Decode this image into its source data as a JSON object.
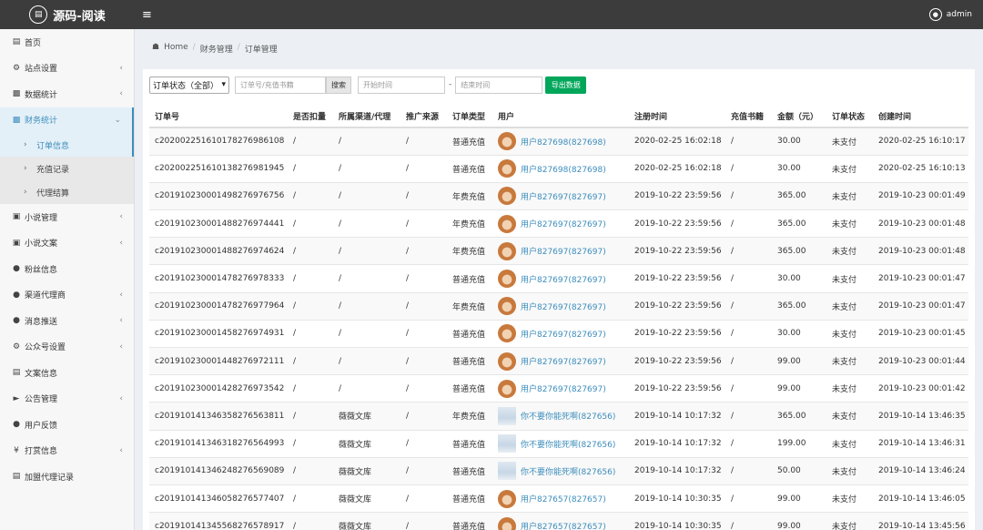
{
  "header": {
    "brand": "源码-阅读",
    "user": "admin",
    "menu_icon": "bars-icon"
  },
  "sidebar": {
    "items": [
      {
        "label": "首页",
        "icon": "dashboard-icon",
        "chev": false
      },
      {
        "label": "站点设置",
        "icon": "gear-icon",
        "chev": true
      },
      {
        "label": "数据统计",
        "icon": "bar-chart-icon",
        "chev": true
      },
      {
        "label": "财务统计",
        "icon": "bar-chart-icon",
        "chev": true,
        "active": true
      },
      {
        "label": "小说管理",
        "icon": "book-icon",
        "chev": true
      },
      {
        "label": "小说文案",
        "icon": "book-icon",
        "chev": true
      },
      {
        "label": "粉丝信息",
        "icon": "users-icon",
        "chev": false
      },
      {
        "label": "渠道代理商",
        "icon": "user-plus-icon",
        "chev": true
      },
      {
        "label": "消息推送",
        "icon": "comment-icon",
        "chev": true
      },
      {
        "label": "公众号设置",
        "icon": "cogs-icon",
        "chev": true
      },
      {
        "label": "文案信息",
        "icon": "newspaper-icon",
        "chev": false
      },
      {
        "label": "公告管理",
        "icon": "bullhorn-icon",
        "chev": true
      },
      {
        "label": "用户反馈",
        "icon": "comment-icon",
        "chev": false
      },
      {
        "label": "打赏信息",
        "icon": "yen-icon",
        "chev": true
      },
      {
        "label": "加盟代理记录",
        "icon": "id-card-icon",
        "chev": false
      }
    ],
    "sub_items": [
      "订单信息",
      "充值记录",
      "代理结算"
    ]
  },
  "breadcrumb": [
    "Home",
    "财务管理",
    "订单管理"
  ],
  "filters": {
    "status_select": "订单状态（全部）",
    "search_placeholder": "订单号/充值书籍",
    "search_button": "搜索",
    "start_placeholder": "开始时间",
    "end_placeholder": "结束时间",
    "dash": "-",
    "export_button": "导出数据"
  },
  "table": {
    "columns": [
      "订单号",
      "是否扣量",
      "所属渠道/代理",
      "推广来源",
      "订单类型",
      "用户",
      "注册时间",
      "充值书籍",
      "金额（元）",
      "订单状态",
      "创建时间"
    ],
    "rows": [
      [
        "c202002251610178276986108",
        "/",
        "/",
        "/",
        "普通充值",
        "用户827698(827698)",
        "2020-02-25 16:02:18",
        "/",
        "30.00",
        "未支付",
        "2020-02-25 16:10:17",
        "avatar"
      ],
      [
        "c202002251610138276981945",
        "/",
        "/",
        "/",
        "普通充值",
        "用户827698(827698)",
        "2020-02-25 16:02:18",
        "/",
        "30.00",
        "未支付",
        "2020-02-25 16:10:13",
        "avatar"
      ],
      [
        "c201910230001498276976756",
        "/",
        "/",
        "/",
        "年费充值",
        "用户827697(827697)",
        "2019-10-22 23:59:56",
        "/",
        "365.00",
        "未支付",
        "2019-10-23 00:01:49",
        "avatar"
      ],
      [
        "c201910230001488276974441",
        "/",
        "/",
        "/",
        "年费充值",
        "用户827697(827697)",
        "2019-10-22 23:59:56",
        "/",
        "365.00",
        "未支付",
        "2019-10-23 00:01:48",
        "avatar"
      ],
      [
        "c201910230001488276974624",
        "/",
        "/",
        "/",
        "年费充值",
        "用户827697(827697)",
        "2019-10-22 23:59:56",
        "/",
        "365.00",
        "未支付",
        "2019-10-23 00:01:48",
        "avatar"
      ],
      [
        "c201910230001478276978333",
        "/",
        "/",
        "/",
        "普通充值",
        "用户827697(827697)",
        "2019-10-22 23:59:56",
        "/",
        "30.00",
        "未支付",
        "2019-10-23 00:01:47",
        "avatar"
      ],
      [
        "c201910230001478276977964",
        "/",
        "/",
        "/",
        "年费充值",
        "用户827697(827697)",
        "2019-10-22 23:59:56",
        "/",
        "365.00",
        "未支付",
        "2019-10-23 00:01:47",
        "avatar"
      ],
      [
        "c201910230001458276974931",
        "/",
        "/",
        "/",
        "普通充值",
        "用户827697(827697)",
        "2019-10-22 23:59:56",
        "/",
        "30.00",
        "未支付",
        "2019-10-23 00:01:45",
        "avatar"
      ],
      [
        "c201910230001448276972111",
        "/",
        "/",
        "/",
        "普通充值",
        "用户827697(827697)",
        "2019-10-22 23:59:56",
        "/",
        "99.00",
        "未支付",
        "2019-10-23 00:01:44",
        "avatar"
      ],
      [
        "c201910230001428276973542",
        "/",
        "/",
        "/",
        "普通充值",
        "用户827697(827697)",
        "2019-10-22 23:59:56",
        "/",
        "99.00",
        "未支付",
        "2019-10-23 00:01:42",
        "avatar"
      ],
      [
        "c201910141346358276563811",
        "/",
        "薇薇文库",
        "/",
        "年费充值",
        "你不要你能死啊(827656)",
        "2019-10-14 10:17:32",
        "/",
        "365.00",
        "未支付",
        "2019-10-14 13:46:35",
        "pic"
      ],
      [
        "c201910141346318276564993",
        "/",
        "薇薇文库",
        "/",
        "普通充值",
        "你不要你能死啊(827656)",
        "2019-10-14 10:17:32",
        "/",
        "199.00",
        "未支付",
        "2019-10-14 13:46:31",
        "pic"
      ],
      [
        "c201910141346248276569089",
        "/",
        "薇薇文库",
        "/",
        "普通充值",
        "你不要你能死啊(827656)",
        "2019-10-14 10:17:32",
        "/",
        "50.00",
        "未支付",
        "2019-10-14 13:46:24",
        "pic"
      ],
      [
        "c201910141346058276577407",
        "/",
        "薇薇文库",
        "/",
        "普通充值",
        "用户827657(827657)",
        "2019-10-14 10:30:35",
        "/",
        "99.00",
        "未支付",
        "2019-10-14 13:46:05",
        "avatar"
      ],
      [
        "c201910141345568276578917",
        "/",
        "薇薇文库",
        "/",
        "普通充值",
        "用户827657(827657)",
        "2019-10-14 10:30:35",
        "/",
        "99.00",
        "未支付",
        "2019-10-14 13:45:56",
        "avatar"
      ]
    ]
  },
  "colors": {
    "topbar": "#3c3c3c",
    "accent": "#3c8dbc",
    "export": "#00a65a"
  }
}
